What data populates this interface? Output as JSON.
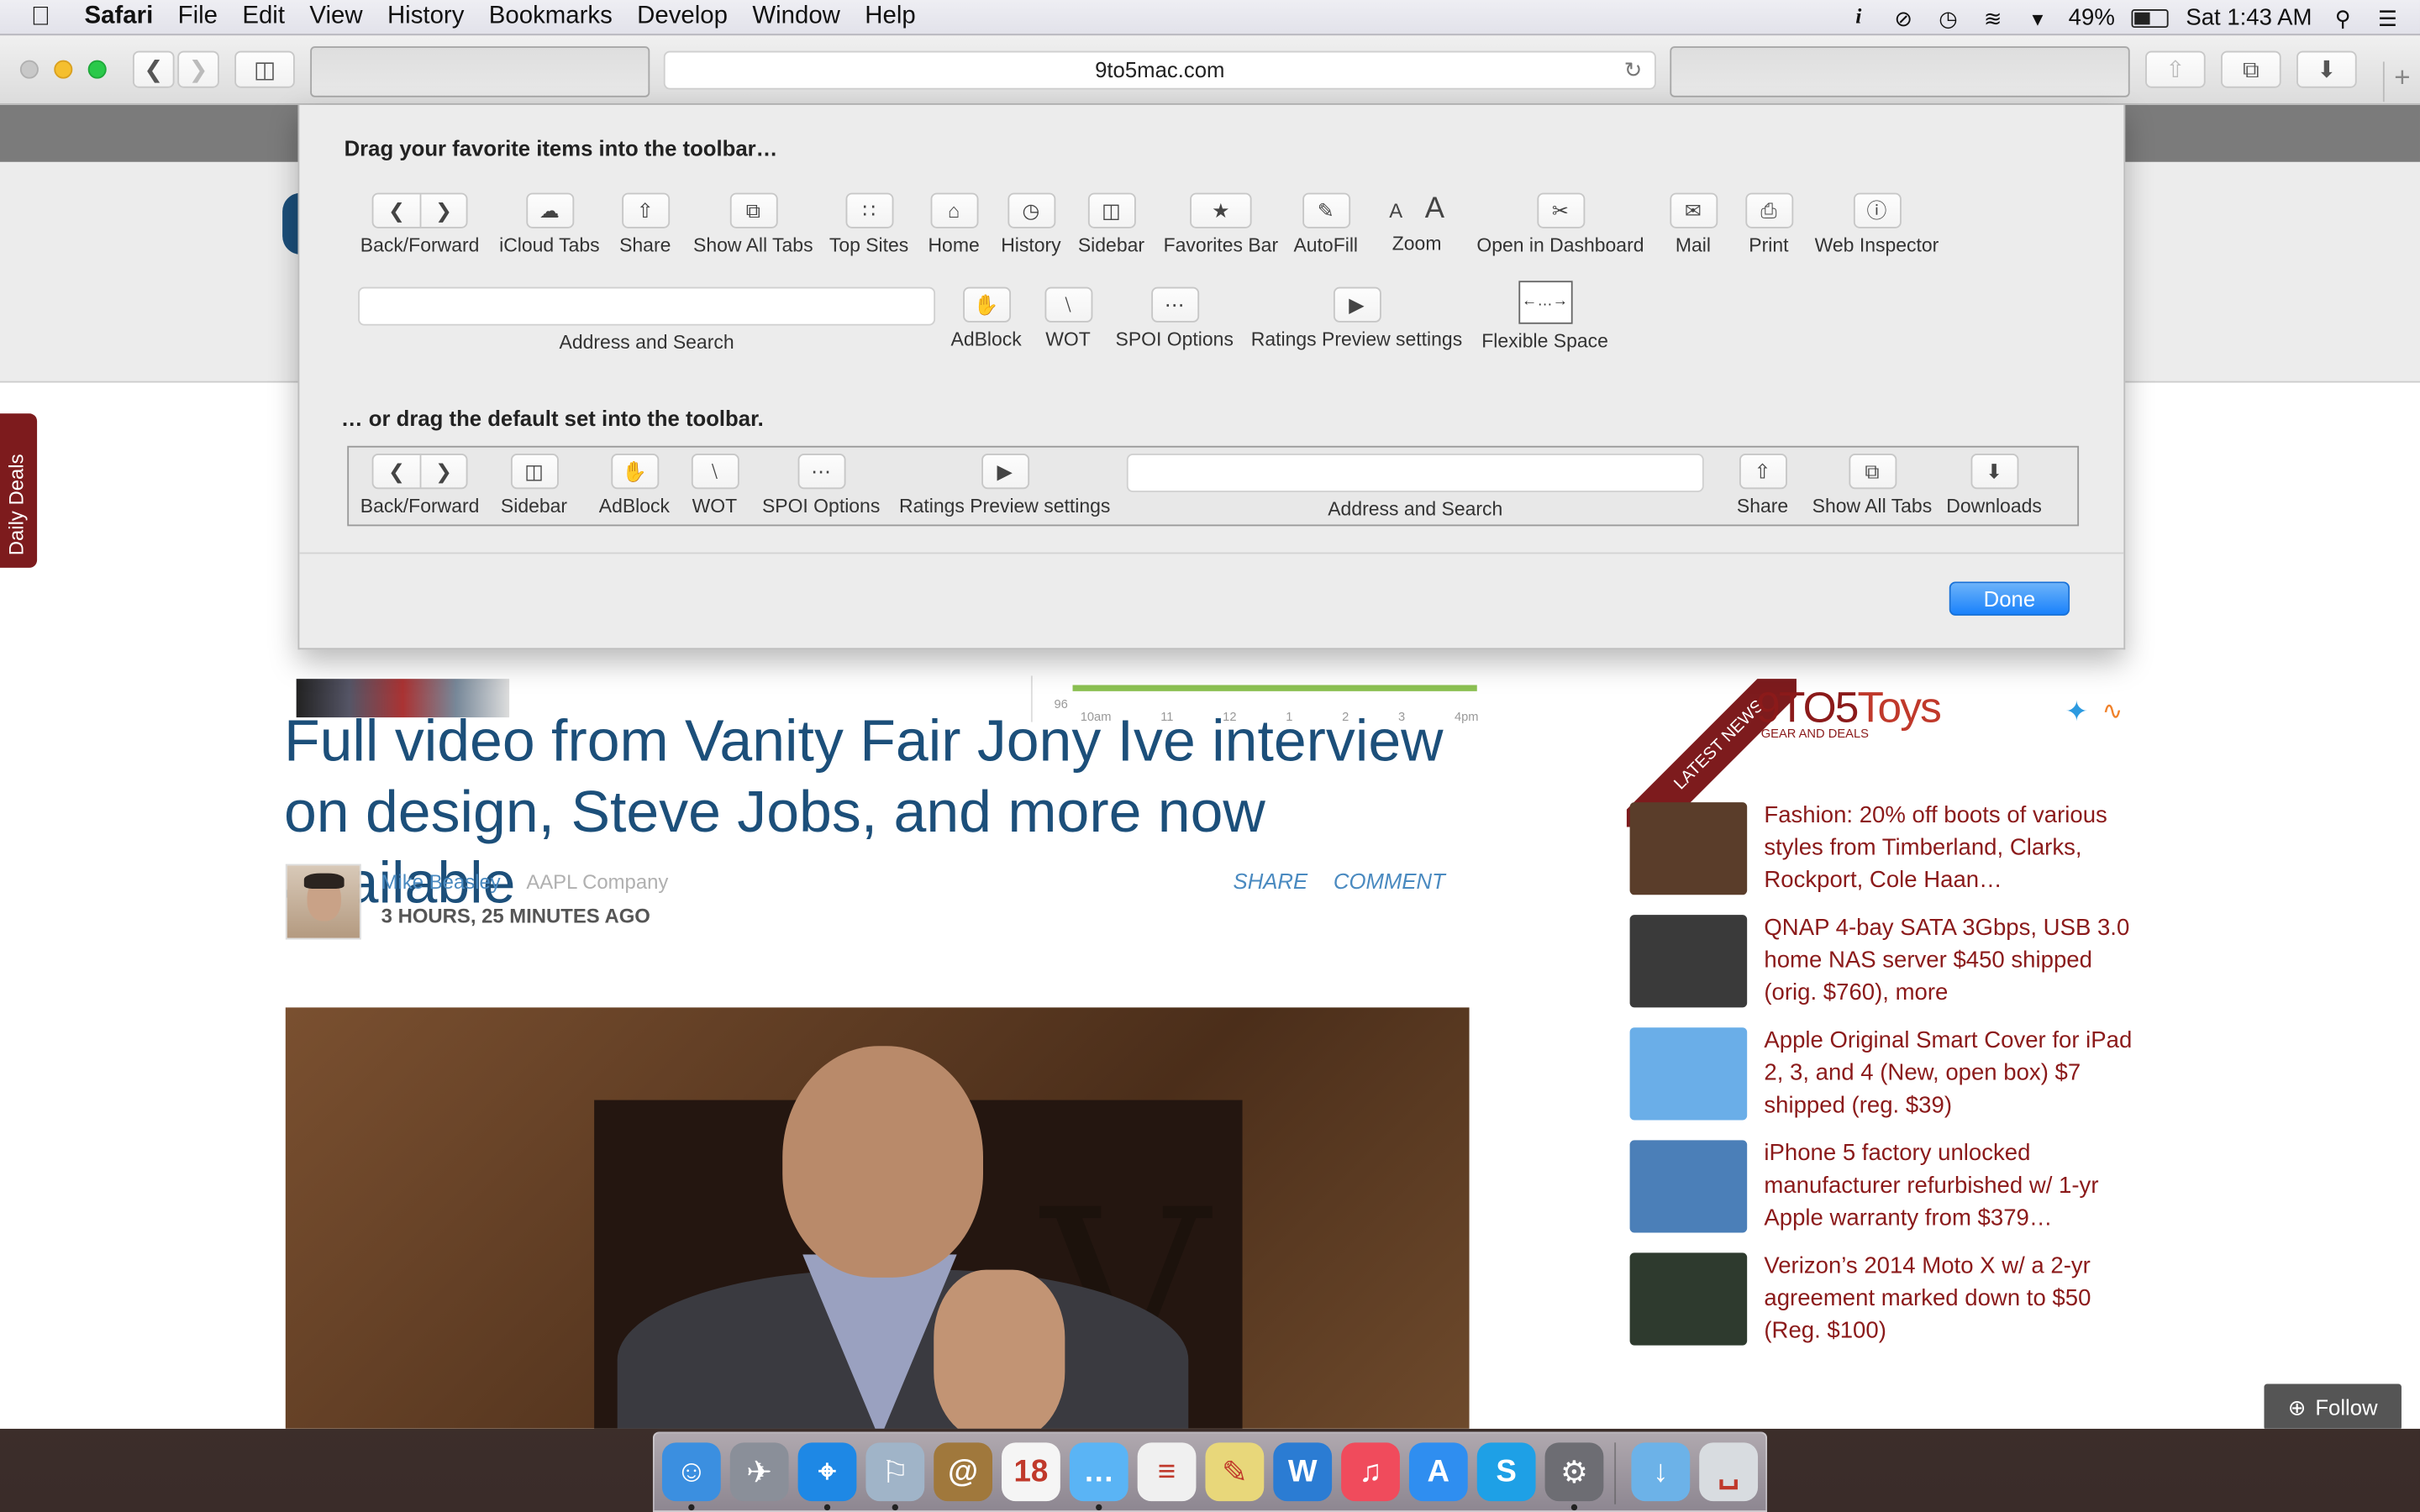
{
  "menubar": {
    "app_name": "Safari",
    "items": [
      "File",
      "Edit",
      "View",
      "History",
      "Bookmarks",
      "Develop",
      "Window",
      "Help"
    ],
    "battery": "49%",
    "clock": "Sat 1:43 AM"
  },
  "browser": {
    "url": "9to5mac.com"
  },
  "customize": {
    "title": "Drag your favorite items into the toolbar…",
    "default_title": "… or drag the default set into the toolbar.",
    "row1": [
      "Back/Forward",
      "iCloud Tabs",
      "Share",
      "Show All Tabs",
      "Top Sites",
      "Home",
      "History",
      "Sidebar",
      "Favorites Bar",
      "AutoFill",
      "Zoom",
      "Open in Dashboard",
      "Mail",
      "Print",
      "Web Inspector"
    ],
    "row2": [
      "Address and Search",
      "AdBlock",
      "WOT",
      "SPOI Options",
      "Ratings Preview settings",
      "Flexible Space"
    ],
    "default_set": [
      "Back/Forward",
      "Sidebar",
      "AdBlock",
      "WOT",
      "SPOI Options",
      "Ratings Preview settings",
      "Address and Search",
      "Share",
      "Show All Tabs",
      "Downloads"
    ],
    "zoom_glyphs": [
      "A",
      "A"
    ],
    "done_label": "Done"
  },
  "sidebar_tab": "Daily Deals",
  "article": {
    "headline": "Full video from Vanity Fair Jony Ive interview on design, Steve Jobs, and more now available",
    "author": "Mike Beasley",
    "company": "AAPL Company",
    "time_ago": "3 HOURS, 25 MINUTES AGO",
    "share_label": "SHARE",
    "comment_label": "COMMENT"
  },
  "chart_fragment": {
    "y_tick": "96",
    "x_ticks": [
      "10am",
      "11",
      "12",
      "1",
      "2",
      "3",
      "4pm"
    ]
  },
  "news": {
    "badge": "LATEST NEWS",
    "logo_main": "9TO5",
    "logo_accent": "Toys",
    "logo_sub": "GEAR AND DEALS",
    "items": [
      {
        "text": "Fashion: 20% off boots of various styles from Timberland, Clarks, Rockport, Cole Haan…",
        "thumb_color": "#5a3d2a"
      },
      {
        "text": "QNAP 4-bay SATA 3Gbps, USB 3.0 home NAS server $450 shipped (orig. $760), more",
        "thumb_color": "#3a3a3a"
      },
      {
        "text": "Apple Original Smart Cover for iPad 2, 3, and 4 (New, open box) $7 shipped (reg. $39)",
        "thumb_color": "#6aaee8"
      },
      {
        "text": "iPhone 5 factory unlocked manufacturer refurbished w/ 1-yr Apple warranty from $379…",
        "thumb_color": "#4b7fb8"
      },
      {
        "text": "Verizon’s 2014 Moto X w/ a 2-yr agreement marked down to $50 (Reg. $100)",
        "thumb_color": "#2e3a2e"
      }
    ],
    "follow_label": "Follow"
  },
  "dock": {
    "apps": [
      {
        "name": "Finder",
        "color": "#3b8fe0",
        "glyph": "☺"
      },
      {
        "name": "Launchpad",
        "color": "#8a8f99",
        "glyph": "✈"
      },
      {
        "name": "Safari",
        "color": "#1e88e5",
        "glyph": "⌖"
      },
      {
        "name": "Preview",
        "color": "#a0b4c8",
        "glyph": "⚐"
      },
      {
        "name": "Contacts",
        "color": "#a0783c",
        "glyph": "@"
      },
      {
        "name": "Calendar",
        "color": "#f5f5f5",
        "glyph": "18"
      },
      {
        "name": "Messages",
        "color": "#5ab4f5",
        "glyph": "…"
      },
      {
        "name": "Reminders",
        "color": "#f0f0f0",
        "glyph": "≡"
      },
      {
        "name": "Stickies",
        "color": "#e8d77a",
        "glyph": "✎"
      },
      {
        "name": "Word",
        "color": "#2b7cd3",
        "glyph": "W"
      },
      {
        "name": "iTunes",
        "color": "#f04b5c",
        "glyph": "♫"
      },
      {
        "name": "App Store",
        "color": "#2f8ef0",
        "glyph": "A"
      },
      {
        "name": "Skype",
        "color": "#1ea0e6",
        "glyph": "S"
      },
      {
        "name": "System Preferences",
        "color": "#6d6d73",
        "glyph": "⚙"
      },
      {
        "name": "Downloads",
        "color": "#6cb2e8",
        "glyph": "↓"
      },
      {
        "name": "Trash",
        "color": "#d8dce0",
        "glyph": "␣"
      }
    ]
  }
}
